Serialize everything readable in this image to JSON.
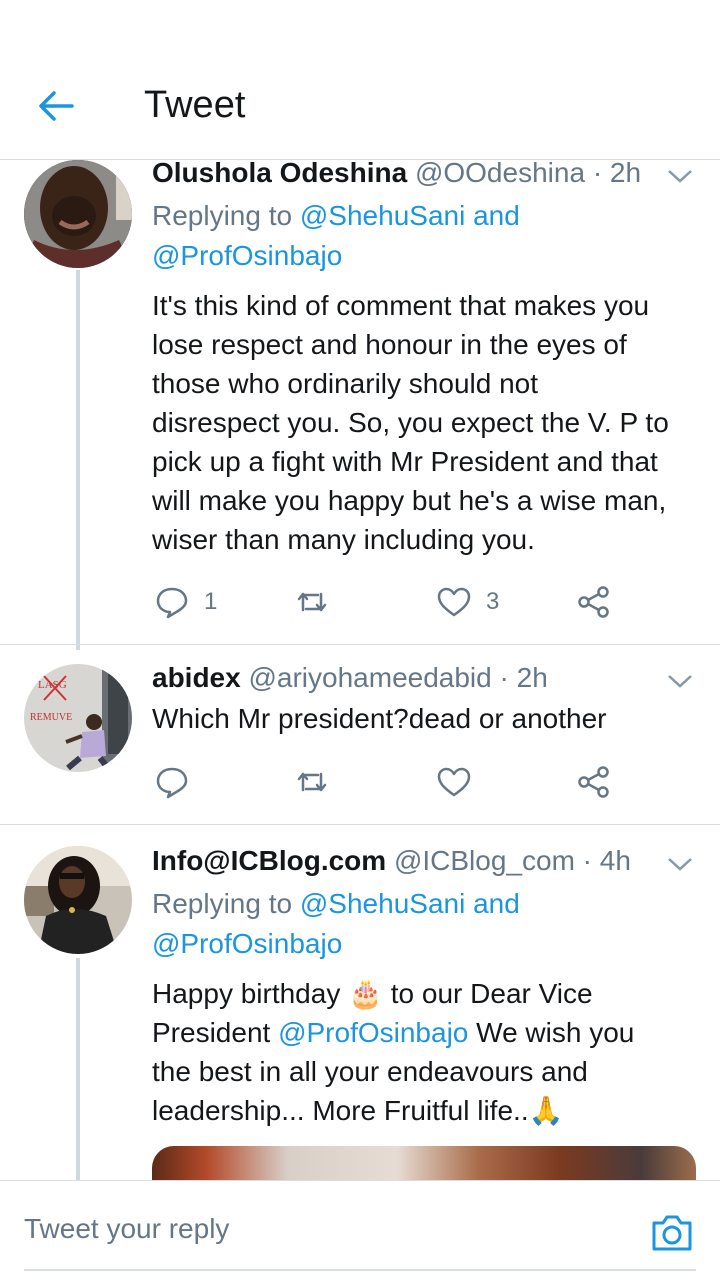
{
  "header": {
    "title": "Tweet",
    "back_icon": "arrow-left-icon"
  },
  "tweets": [
    {
      "name": "Olushola Odeshina",
      "handle": "@OOdeshina",
      "dot": "·",
      "time": "2h",
      "replying_prefix": "Replying to",
      "replying_mention_1": "@ShehuSani",
      "replying_and": "and",
      "replying_mention_2": "@ProfOsinbajo",
      "text_lines": [
        "It's this kind of comment that makes you",
        "lose respect and honour in the eyes of",
        "those who ordinarily should not",
        "disrespect you. So, you expect the V. P to",
        "pick up a fight with Mr President and that",
        "will make you happy but he's a wise man,",
        "wiser than many including you."
      ],
      "reply_count": "1",
      "retweet_count": "",
      "like_count": "3"
    },
    {
      "name": "abidex",
      "handle": "@ariyohameedabid",
      "dot": "·",
      "time": "2h",
      "text": "Which Mr president?dead or another",
      "avatar_texts": [
        "LASG",
        "REMUVE"
      ]
    },
    {
      "name": "Info@ICBlog.com",
      "handle": "@ICBlog_com",
      "dot": "·",
      "time": "4h",
      "replying_prefix": "Replying to",
      "replying_mention_1": "@ShehuSani",
      "replying_and": "and",
      "replying_mention_2": "@ProfOsinbajo",
      "line1_a": "Happy birthday",
      "line1_emoji": "🎂",
      "line1_b": "to our Dear Vice",
      "line2_a": "President",
      "line2_mention": "@ProfOsinbajo",
      "line2_b": "We wish you",
      "line3": "the best in all your endeavours and",
      "line4": "leadership... More Fruitful life..",
      "line4_emoji": "🙏"
    }
  ],
  "composer": {
    "placeholder": "Tweet your reply",
    "camera_icon": "camera-icon"
  },
  "colors": {
    "accent": "#1b95e0",
    "secondary_text": "#657786",
    "divider": "#d8dee3"
  }
}
